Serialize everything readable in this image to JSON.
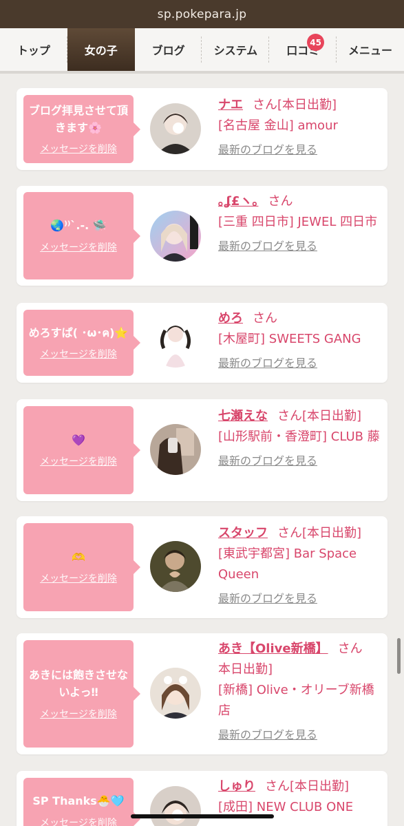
{
  "browser": {
    "url": "sp.pokepara.jp"
  },
  "nav": {
    "tabs": [
      {
        "label": "トップ"
      },
      {
        "label": "女の子"
      },
      {
        "label": "ブログ"
      },
      {
        "label": "システム"
      },
      {
        "label": "口コミ"
      },
      {
        "label": "メニュー"
      }
    ],
    "review_badge": "45",
    "active_tab": 1
  },
  "common": {
    "delete_label": "メッセージを削除",
    "blog_link_label": "最新のブログを見る",
    "san": "さん"
  },
  "cards": [
    {
      "message": "ブログ拝見させて頂きます🌸",
      "name": "ナエ",
      "status": "[本日出勤]",
      "shop": "[名古屋 金山] amour",
      "avatar_color": "#cfc7c0"
    },
    {
      "message": "🌏⁾⁾`.-. 🛸",
      "name": "｡ʆ£ヽ｡",
      "status": "",
      "shop": "[三重 四日市] JEWEL 四日市",
      "avatar_color": "#b6a2c8"
    },
    {
      "message": "めろすぱ( ･ω･ค)⭐️",
      "name": "めろ",
      "status": "",
      "shop": "[木屋町] SWEETS GANG",
      "avatar_color": "#f0e6e4"
    },
    {
      "message": "💜",
      "name": "七瀬えな",
      "status": "[本日出勤]",
      "shop": "[山形駅前・香澄町] CLUB 藤",
      "avatar_color": "#8d7a6e"
    },
    {
      "message": "🫶",
      "name": "スタッフ",
      "status": "[本日出勤]",
      "shop": "[東武宇都宮] Bar Space Queen",
      "avatar_color": "#6b6440"
    },
    {
      "message": "あきには飽きさせないよっ‼︎",
      "name": "あき【Olive新橋】",
      "status": "本日出勤]",
      "shop": "[新橋] Olive・オリーブ新橋店",
      "avatar_color": "#d9c7b8"
    },
    {
      "message": "SP Thanks🐣🩵",
      "name": "しゅり",
      "status": "[本日出勤]",
      "shop": "[成田] NEW CLUB ONE",
      "avatar_color": "#c9bdb6"
    }
  ]
}
